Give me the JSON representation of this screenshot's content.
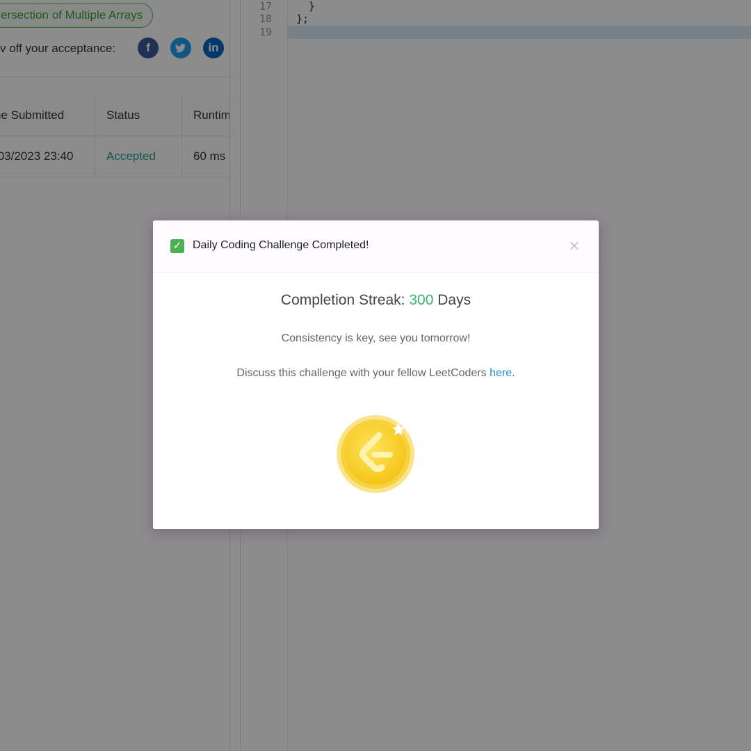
{
  "left_panel": {
    "tag": "ersection of Multiple Arrays",
    "share_text": "v off your acceptance:",
    "social": {
      "facebook": "f",
      "twitter": "t",
      "linkedin": "in"
    },
    "table": {
      "headers": [
        "ne Submitted",
        "Status",
        "Runtim"
      ],
      "rows": [
        {
          "time": "/03/2023 23:40",
          "status": "Accepted",
          "runtime": "60 ms"
        }
      ]
    }
  },
  "editor": {
    "lines": [
      {
        "num": "17",
        "code": "  }"
      },
      {
        "num": "18",
        "code": "};"
      },
      {
        "num": "19",
        "code": ""
      }
    ]
  },
  "modal": {
    "title": "Daily Coding Challenge Completed!",
    "check_glyph": "✓",
    "close_glyph": "×",
    "streak_prefix": "Completion Streak: ",
    "streak_value": "300",
    "streak_suffix": " Days",
    "tagline": "Consistency is key, see you tomorrow!",
    "discuss_prefix": "Discuss this challenge with your fellow LeetCoders ",
    "discuss_link": "here",
    "discuss_suffix": "."
  },
  "colors": {
    "accent_green": "#3cb371",
    "link_blue": "#1a8fd1",
    "coin_gold": "#f5c518"
  }
}
